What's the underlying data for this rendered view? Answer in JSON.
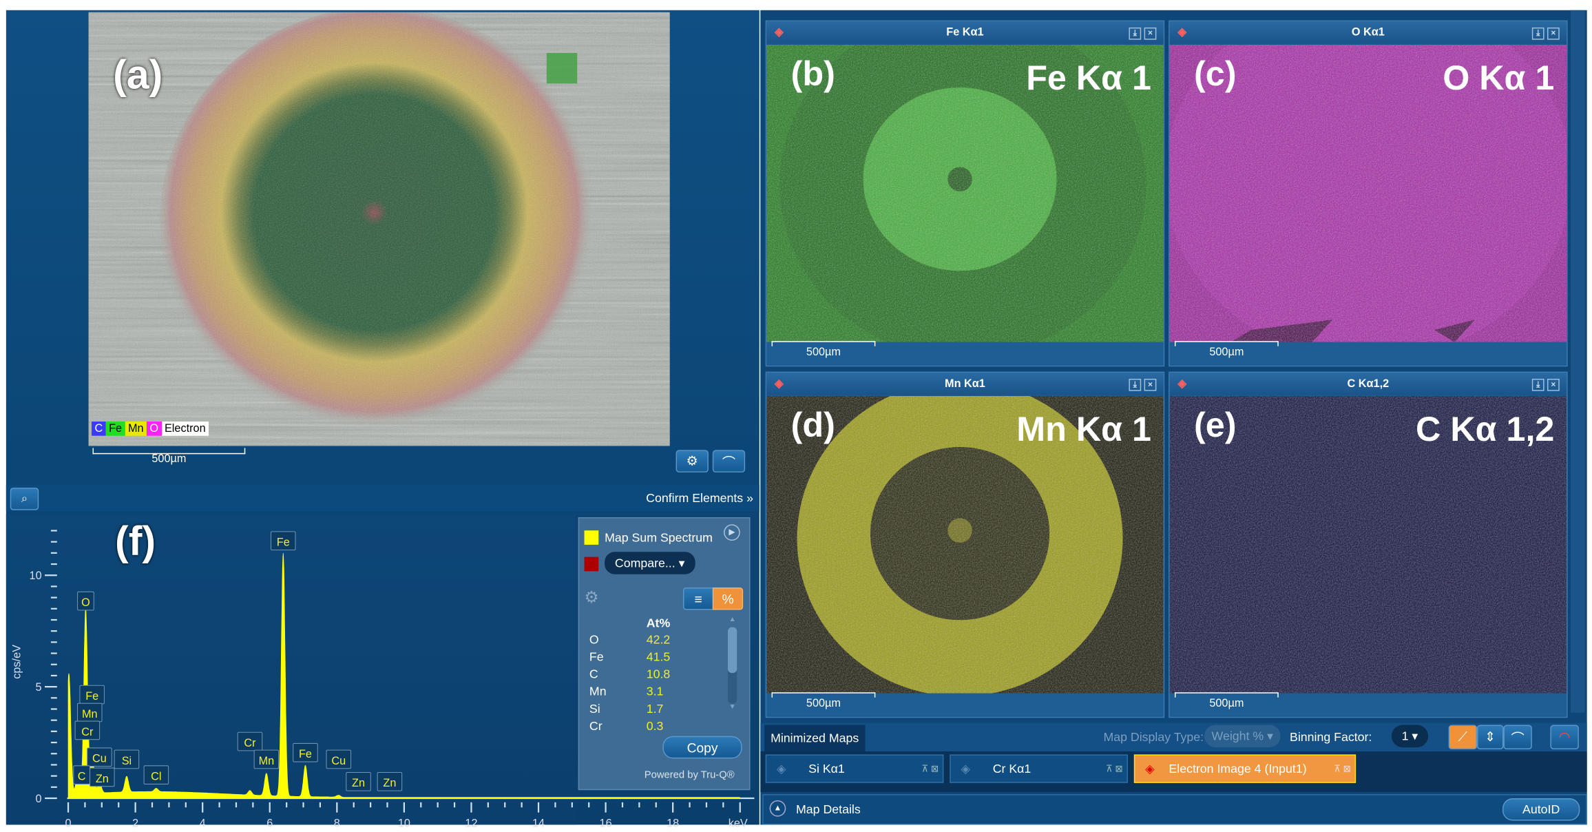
{
  "electron_image": {
    "panel_label": "(a)",
    "scale": "500µm",
    "legend": [
      {
        "el": "C",
        "color": "#3a3aff"
      },
      {
        "el": "Fe",
        "color": "#22dd22"
      },
      {
        "el": "Mn",
        "color": "#e8e800"
      },
      {
        "el": "O",
        "color": "#ff22ff"
      }
    ],
    "legend_electron": "Electron"
  },
  "spectrum": {
    "panel_label": "(f)",
    "confirm_label": "Confirm Elements »"
  },
  "side": {
    "series_label": "Map Sum Spectrum",
    "compare_label": "Compare...",
    "col_header": "At%",
    "rows": [
      {
        "el": "O",
        "val": "42.2"
      },
      {
        "el": "Fe",
        "val": "41.5"
      },
      {
        "el": "C",
        "val": "10.8"
      },
      {
        "el": "Mn",
        "val": "3.1"
      },
      {
        "el": "Si",
        "val": "1.7"
      },
      {
        "el": "Cr",
        "val": "0.3"
      }
    ],
    "copy_label": "Copy",
    "powered": "Powered by Tru-Q®",
    "series_color": "#ffff00",
    "compare_color": "#aa0000"
  },
  "maps": [
    {
      "title": "Fe Kα1",
      "panel_label": "(b)",
      "big_label": "Fe Kα 1",
      "scale": "500µm",
      "color": "#22cc22"
    },
    {
      "title": "O Kα1",
      "panel_label": "(c)",
      "big_label": "O Kα 1",
      "scale": "500µm",
      "color": "#cc22cc"
    },
    {
      "title": "Mn Kα1",
      "panel_label": "(d)",
      "big_label": "Mn Kα 1",
      "scale": "500µm",
      "color": "#cccc00"
    },
    {
      "title": "C Kα1,2",
      "panel_label": "(e)",
      "big_label": "C Kα 1,2",
      "scale": "500µm",
      "color": "#2222aa"
    }
  ],
  "bottom": {
    "minimized_tab": "Minimized Maps",
    "display_type_label": "Map Display Type:",
    "display_type_value": "Weight %",
    "binning_label": "Binning Factor:",
    "binning_value": "1",
    "mini_maps": [
      "Si Kα1",
      "Cr Kα1",
      "Electron Image 4 (Input1)"
    ],
    "map_details": "Map Details",
    "autoid": "AutoID"
  },
  "chart_data": {
    "type": "line",
    "title": "",
    "xlabel": "keV",
    "ylabel": "cps/eV",
    "xlim": [
      0,
      20
    ],
    "ylim": [
      0,
      12
    ],
    "xticks": [
      "0",
      "2",
      "4",
      "6",
      "8",
      "10",
      "12",
      "14",
      "16",
      "18"
    ],
    "yticks": [
      "0",
      "5",
      "10"
    ],
    "series": [
      {
        "name": "Map Sum Spectrum",
        "color": "#ffff00",
        "peaks": [
          {
            "keV": 0.02,
            "h": 5.6
          },
          {
            "keV": 0.28,
            "h": 0.8
          },
          {
            "keV": 0.52,
            "h": 8.3
          },
          {
            "keV": 0.71,
            "h": 1.8
          },
          {
            "keV": 0.93,
            "h": 0.5
          },
          {
            "keV": 1.74,
            "h": 0.7
          },
          {
            "keV": 2.62,
            "h": 0.15
          },
          {
            "keV": 5.41,
            "h": 0.2
          },
          {
            "keV": 5.9,
            "h": 1.0
          },
          {
            "keV": 6.4,
            "h": 10.9
          },
          {
            "keV": 7.06,
            "h": 1.4
          },
          {
            "keV": 8.05,
            "h": 0.1
          }
        ]
      }
    ],
    "annotations": [
      {
        "text": "Fe",
        "keV": 6.4,
        "y": 11.5
      },
      {
        "text": "O",
        "keV": 0.52,
        "y": 8.8
      },
      {
        "text": "Fe",
        "keV": 0.71,
        "y": 4.6
      },
      {
        "text": "Mn",
        "keV": 0.64,
        "y": 3.8
      },
      {
        "text": "Cr",
        "keV": 0.57,
        "y": 3.0
      },
      {
        "text": "Cu",
        "keV": 0.93,
        "y": 1.8
      },
      {
        "text": "C",
        "keV": 0.28,
        "y": 1.0
      },
      {
        "text": "Zn",
        "keV": 1.01,
        "y": 0.9
      },
      {
        "text": "Si",
        "keV": 1.74,
        "y": 1.7
      },
      {
        "text": "Cl",
        "keV": 2.62,
        "y": 1.0
      },
      {
        "text": "Cr",
        "keV": 5.41,
        "y": 2.5
      },
      {
        "text": "Mn",
        "keV": 5.9,
        "y": 1.7
      },
      {
        "text": "Fe",
        "keV": 7.06,
        "y": 2.0
      },
      {
        "text": "Cu",
        "keV": 8.05,
        "y": 1.7
      },
      {
        "text": "Zn",
        "keV": 8.64,
        "y": 0.7
      },
      {
        "text": "Zn",
        "keV": 9.57,
        "y": 0.7
      }
    ]
  }
}
